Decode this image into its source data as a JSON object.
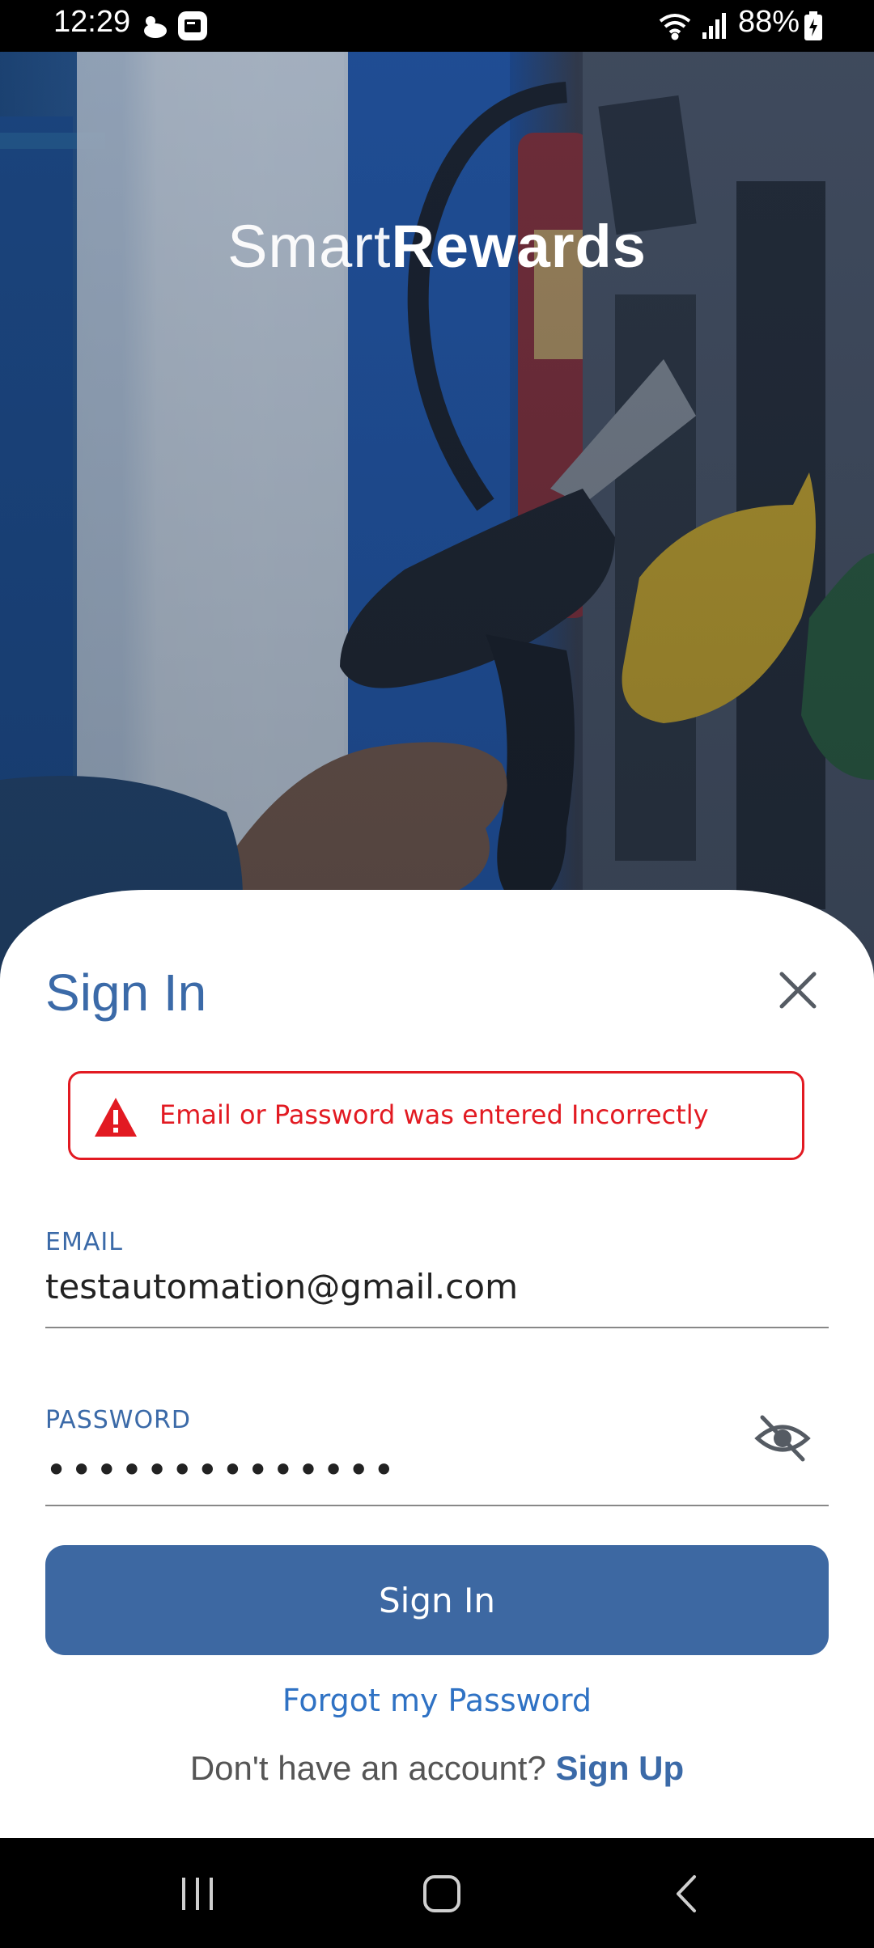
{
  "status_bar": {
    "time": "12:29",
    "battery": "88%",
    "icons": [
      "weather-icon",
      "app-notification-icon",
      "wifi-icon",
      "signal-icon",
      "battery-charging-icon"
    ]
  },
  "hero": {
    "brand_light": "Smart",
    "brand_bold": "Rewards"
  },
  "sign_in": {
    "title": "Sign In",
    "close_icon": "close-icon",
    "error_message": "Email or Password was entered Incorrectly",
    "email_label": "EMAIL",
    "email_value": "testautomation@gmail.com",
    "password_label": "PASSWORD",
    "password_value": "••••••••••••••",
    "submit_label": "Sign In",
    "forgot_label": "Forgot my Password",
    "no_account_text": "Don't have an account?",
    "signup_label": "Sign Up"
  },
  "colors": {
    "accent": "#3b6aa8",
    "button": "#3d68a2",
    "error": "#e21a22",
    "link": "#2f72c4"
  },
  "nav_bar": {
    "items": [
      "recents-icon",
      "home-icon",
      "back-icon"
    ]
  }
}
